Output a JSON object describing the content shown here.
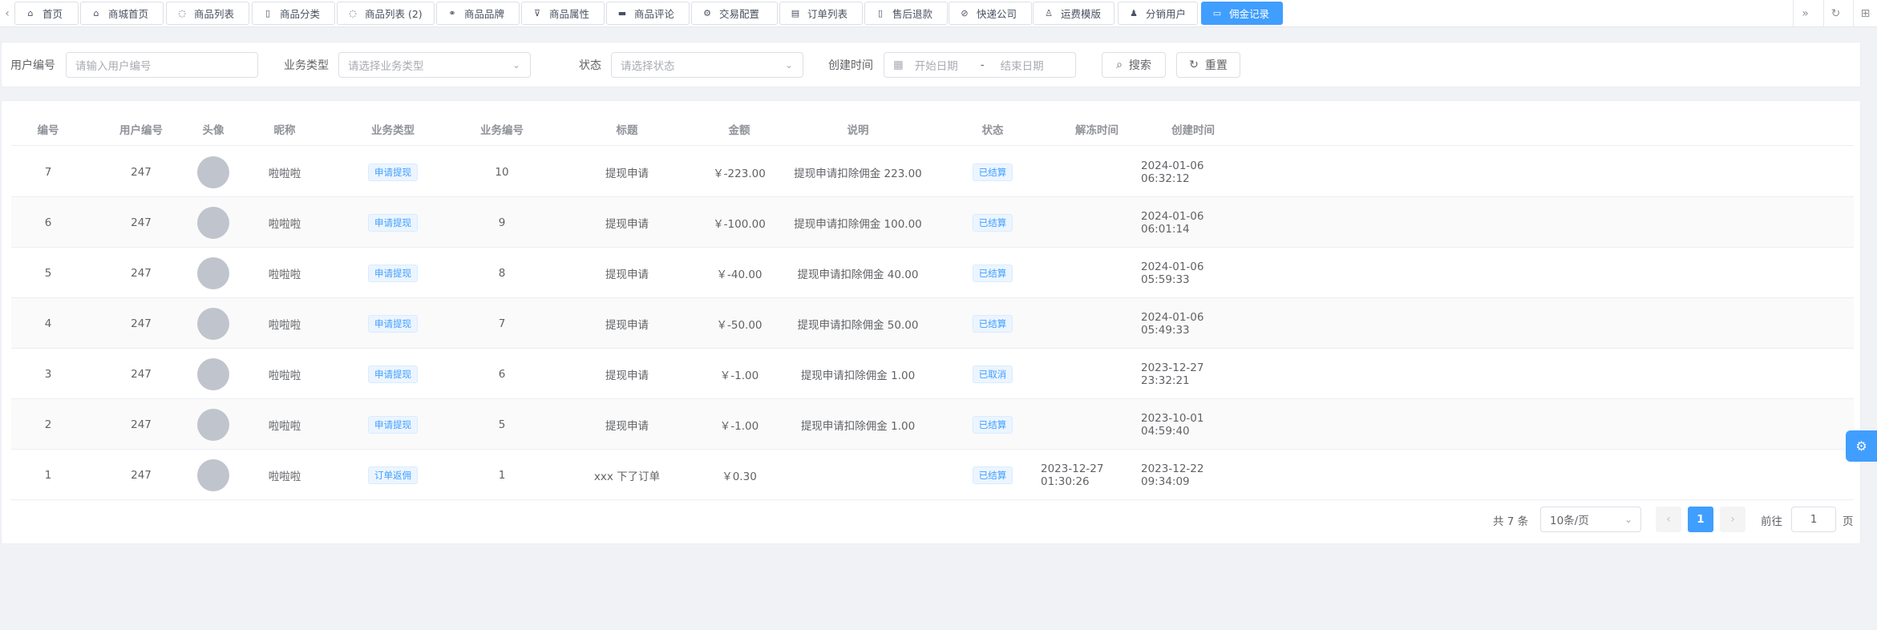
{
  "tabs": [
    {
      "label": "首页",
      "icon": "home-icon",
      "glyph": "⌂"
    },
    {
      "label": "商城首页",
      "icon": "home-icon",
      "glyph": "⌂"
    },
    {
      "label": "商品列表",
      "icon": "box-icon",
      "glyph": "◌"
    },
    {
      "label": "商品分类",
      "icon": "folder-icon",
      "glyph": "▯"
    },
    {
      "label": "商品列表 (2)",
      "icon": "box-icon",
      "glyph": "◌"
    },
    {
      "label": "商品品牌",
      "icon": "link-icon",
      "glyph": "⚭"
    },
    {
      "label": "商品属性",
      "icon": "filter-icon",
      "glyph": "⊽"
    },
    {
      "label": "商品评论",
      "icon": "comment-icon",
      "glyph": "▬"
    },
    {
      "label": "交易配置",
      "icon": "gear-icon",
      "glyph": "⚙"
    },
    {
      "label": "订单列表",
      "icon": "list-icon",
      "glyph": "▤"
    },
    {
      "label": "售后退款",
      "icon": "refund-icon",
      "glyph": "▯"
    },
    {
      "label": "快递公司",
      "icon": "check-circle-icon",
      "glyph": "⊘"
    },
    {
      "label": "运费模版",
      "icon": "user-icon",
      "glyph": "♙"
    },
    {
      "label": "分销用户",
      "icon": "user-icon",
      "glyph": "♟"
    },
    {
      "label": "佣金记录",
      "icon": "wallet-icon",
      "glyph": "▭"
    }
  ],
  "search": {
    "user_id_label": "用户编号",
    "user_id_placeholder": "请输入用户编号",
    "biz_type_label": "业务类型",
    "biz_type_placeholder": "请选择业务类型",
    "status_label": "状态",
    "status_placeholder": "请选择状态",
    "created_label": "创建时间",
    "start_placeholder": "开始日期",
    "range_sep": "-",
    "end_placeholder": "结束日期",
    "search_btn": "搜索",
    "reset_btn": "重置"
  },
  "table": {
    "headers": [
      "编号",
      "用户编号",
      "头像",
      "昵称",
      "业务类型",
      "业务编号",
      "标题",
      "金额",
      "说明",
      "状态",
      "解冻时间",
      "创建时间"
    ],
    "rows": [
      {
        "id": "7",
        "user_id": "247",
        "nickname": "啦啦啦",
        "biz_type": "申请提现",
        "biz_id": "10",
        "title": "提现申请",
        "amount": "￥-223.00",
        "desc": "提现申请扣除佣金 223.00",
        "status": "已结算",
        "unfreeze": "",
        "created": "2024-01-06 06:32:12"
      },
      {
        "id": "6",
        "user_id": "247",
        "nickname": "啦啦啦",
        "biz_type": "申请提现",
        "biz_id": "9",
        "title": "提现申请",
        "amount": "￥-100.00",
        "desc": "提现申请扣除佣金 100.00",
        "status": "已结算",
        "unfreeze": "",
        "created": "2024-01-06 06:01:14"
      },
      {
        "id": "5",
        "user_id": "247",
        "nickname": "啦啦啦",
        "biz_type": "申请提现",
        "biz_id": "8",
        "title": "提现申请",
        "amount": "￥-40.00",
        "desc": "提现申请扣除佣金 40.00",
        "status": "已结算",
        "unfreeze": "",
        "created": "2024-01-06 05:59:33"
      },
      {
        "id": "4",
        "user_id": "247",
        "nickname": "啦啦啦",
        "biz_type": "申请提现",
        "biz_id": "7",
        "title": "提现申请",
        "amount": "￥-50.00",
        "desc": "提现申请扣除佣金 50.00",
        "status": "已结算",
        "unfreeze": "",
        "created": "2024-01-06 05:49:33"
      },
      {
        "id": "3",
        "user_id": "247",
        "nickname": "啦啦啦",
        "biz_type": "申请提现",
        "biz_id": "6",
        "title": "提现申请",
        "amount": "￥-1.00",
        "desc": "提现申请扣除佣金 1.00",
        "status": "已取消",
        "unfreeze": "",
        "created": "2023-12-27 23:32:21"
      },
      {
        "id": "2",
        "user_id": "247",
        "nickname": "啦啦啦",
        "biz_type": "申请提现",
        "biz_id": "5",
        "title": "提现申请",
        "amount": "￥-1.00",
        "desc": "提现申请扣除佣金 1.00",
        "status": "已结算",
        "unfreeze": "",
        "created": "2023-10-01 04:59:40"
      },
      {
        "id": "1",
        "user_id": "247",
        "nickname": "啦啦啦",
        "biz_type": "订单返佣",
        "biz_id": "1",
        "title": "xxx 下了订单",
        "amount": "￥0.30",
        "desc": "",
        "status": "已结算",
        "unfreeze": "2023-12-27 01:30:26",
        "created": "2023-12-22 09:34:09"
      }
    ]
  },
  "pagination": {
    "total": "共 7 条",
    "page_size": "10条/页",
    "current_page": "1",
    "goto_label": "前往",
    "goto_value": "1",
    "page_suffix": "页"
  },
  "colors": {
    "primary": "#409eff",
    "tag_bg": "#ecf5ff"
  }
}
